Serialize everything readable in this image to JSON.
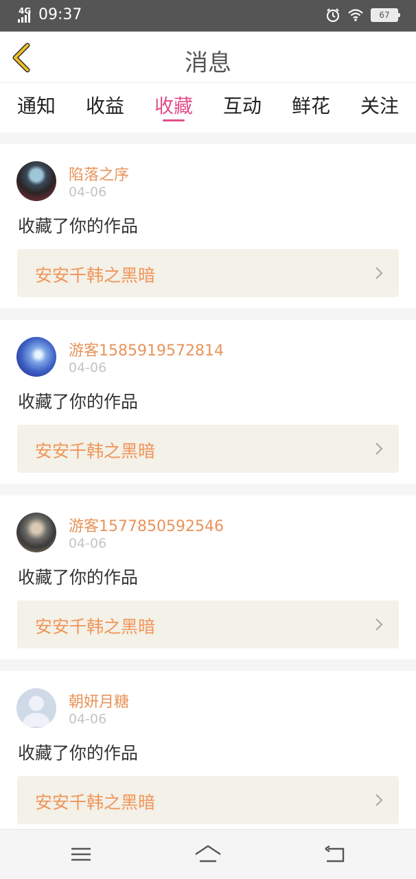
{
  "status_bar": {
    "network": "4G",
    "time": "09:37",
    "battery": "67"
  },
  "header": {
    "title": "消息"
  },
  "tabs": [
    {
      "label": "通知",
      "active": false
    },
    {
      "label": "收益",
      "active": false
    },
    {
      "label": "收藏",
      "active": true
    },
    {
      "label": "互动",
      "active": false
    },
    {
      "label": "鲜花",
      "active": false
    },
    {
      "label": "关注",
      "active": false
    }
  ],
  "messages": [
    {
      "user": "陷落之序",
      "date": "04-06",
      "action": "收藏了你的作品",
      "work": "安安千韩之黑暗"
    },
    {
      "user": "游客1585919572814",
      "date": "04-06",
      "action": "收藏了你的作品",
      "work": "安安千韩之黑暗"
    },
    {
      "user": "游客1577850592546",
      "date": "04-06",
      "action": "收藏了你的作品",
      "work": "安安千韩之黑暗"
    },
    {
      "user": "朝妍月糖",
      "date": "04-06",
      "action": "收藏了你的作品",
      "work": "安安千韩之黑暗"
    }
  ],
  "colors": {
    "accent": "#e2508b",
    "username": "#e8935a",
    "work_title": "#f09558",
    "back_arrow": "#f0c020"
  },
  "icons": {
    "back": "back-arrow-icon",
    "alarm": "alarm-icon",
    "wifi": "wifi-icon",
    "battery": "battery-icon",
    "chevron": "chevron-right-icon",
    "menu": "menu-icon",
    "home": "home-icon",
    "return": "return-icon"
  }
}
